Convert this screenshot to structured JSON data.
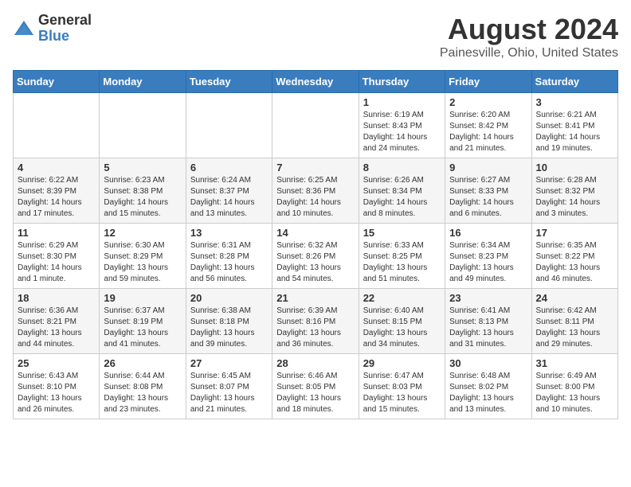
{
  "logo": {
    "general": "General",
    "blue": "Blue"
  },
  "title": "August 2024",
  "subtitle": "Painesville, Ohio, United States",
  "days_header": [
    "Sunday",
    "Monday",
    "Tuesday",
    "Wednesday",
    "Thursday",
    "Friday",
    "Saturday"
  ],
  "weeks": [
    [
      {
        "day": "",
        "info": ""
      },
      {
        "day": "",
        "info": ""
      },
      {
        "day": "",
        "info": ""
      },
      {
        "day": "",
        "info": ""
      },
      {
        "day": "1",
        "info": "Sunrise: 6:19 AM\nSunset: 8:43 PM\nDaylight: 14 hours and 24 minutes."
      },
      {
        "day": "2",
        "info": "Sunrise: 6:20 AM\nSunset: 8:42 PM\nDaylight: 14 hours and 21 minutes."
      },
      {
        "day": "3",
        "info": "Sunrise: 6:21 AM\nSunset: 8:41 PM\nDaylight: 14 hours and 19 minutes."
      }
    ],
    [
      {
        "day": "4",
        "info": "Sunrise: 6:22 AM\nSunset: 8:39 PM\nDaylight: 14 hours and 17 minutes."
      },
      {
        "day": "5",
        "info": "Sunrise: 6:23 AM\nSunset: 8:38 PM\nDaylight: 14 hours and 15 minutes."
      },
      {
        "day": "6",
        "info": "Sunrise: 6:24 AM\nSunset: 8:37 PM\nDaylight: 14 hours and 13 minutes."
      },
      {
        "day": "7",
        "info": "Sunrise: 6:25 AM\nSunset: 8:36 PM\nDaylight: 14 hours and 10 minutes."
      },
      {
        "day": "8",
        "info": "Sunrise: 6:26 AM\nSunset: 8:34 PM\nDaylight: 14 hours and 8 minutes."
      },
      {
        "day": "9",
        "info": "Sunrise: 6:27 AM\nSunset: 8:33 PM\nDaylight: 14 hours and 6 minutes."
      },
      {
        "day": "10",
        "info": "Sunrise: 6:28 AM\nSunset: 8:32 PM\nDaylight: 14 hours and 3 minutes."
      }
    ],
    [
      {
        "day": "11",
        "info": "Sunrise: 6:29 AM\nSunset: 8:30 PM\nDaylight: 14 hours and 1 minute."
      },
      {
        "day": "12",
        "info": "Sunrise: 6:30 AM\nSunset: 8:29 PM\nDaylight: 13 hours and 59 minutes."
      },
      {
        "day": "13",
        "info": "Sunrise: 6:31 AM\nSunset: 8:28 PM\nDaylight: 13 hours and 56 minutes."
      },
      {
        "day": "14",
        "info": "Sunrise: 6:32 AM\nSunset: 8:26 PM\nDaylight: 13 hours and 54 minutes."
      },
      {
        "day": "15",
        "info": "Sunrise: 6:33 AM\nSunset: 8:25 PM\nDaylight: 13 hours and 51 minutes."
      },
      {
        "day": "16",
        "info": "Sunrise: 6:34 AM\nSunset: 8:23 PM\nDaylight: 13 hours and 49 minutes."
      },
      {
        "day": "17",
        "info": "Sunrise: 6:35 AM\nSunset: 8:22 PM\nDaylight: 13 hours and 46 minutes."
      }
    ],
    [
      {
        "day": "18",
        "info": "Sunrise: 6:36 AM\nSunset: 8:21 PM\nDaylight: 13 hours and 44 minutes."
      },
      {
        "day": "19",
        "info": "Sunrise: 6:37 AM\nSunset: 8:19 PM\nDaylight: 13 hours and 41 minutes."
      },
      {
        "day": "20",
        "info": "Sunrise: 6:38 AM\nSunset: 8:18 PM\nDaylight: 13 hours and 39 minutes."
      },
      {
        "day": "21",
        "info": "Sunrise: 6:39 AM\nSunset: 8:16 PM\nDaylight: 13 hours and 36 minutes."
      },
      {
        "day": "22",
        "info": "Sunrise: 6:40 AM\nSunset: 8:15 PM\nDaylight: 13 hours and 34 minutes."
      },
      {
        "day": "23",
        "info": "Sunrise: 6:41 AM\nSunset: 8:13 PM\nDaylight: 13 hours and 31 minutes."
      },
      {
        "day": "24",
        "info": "Sunrise: 6:42 AM\nSunset: 8:11 PM\nDaylight: 13 hours and 29 minutes."
      }
    ],
    [
      {
        "day": "25",
        "info": "Sunrise: 6:43 AM\nSunset: 8:10 PM\nDaylight: 13 hours and 26 minutes."
      },
      {
        "day": "26",
        "info": "Sunrise: 6:44 AM\nSunset: 8:08 PM\nDaylight: 13 hours and 23 minutes."
      },
      {
        "day": "27",
        "info": "Sunrise: 6:45 AM\nSunset: 8:07 PM\nDaylight: 13 hours and 21 minutes."
      },
      {
        "day": "28",
        "info": "Sunrise: 6:46 AM\nSunset: 8:05 PM\nDaylight: 13 hours and 18 minutes."
      },
      {
        "day": "29",
        "info": "Sunrise: 6:47 AM\nSunset: 8:03 PM\nDaylight: 13 hours and 15 minutes."
      },
      {
        "day": "30",
        "info": "Sunrise: 6:48 AM\nSunset: 8:02 PM\nDaylight: 13 hours and 13 minutes."
      },
      {
        "day": "31",
        "info": "Sunrise: 6:49 AM\nSunset: 8:00 PM\nDaylight: 13 hours and 10 minutes."
      }
    ]
  ]
}
